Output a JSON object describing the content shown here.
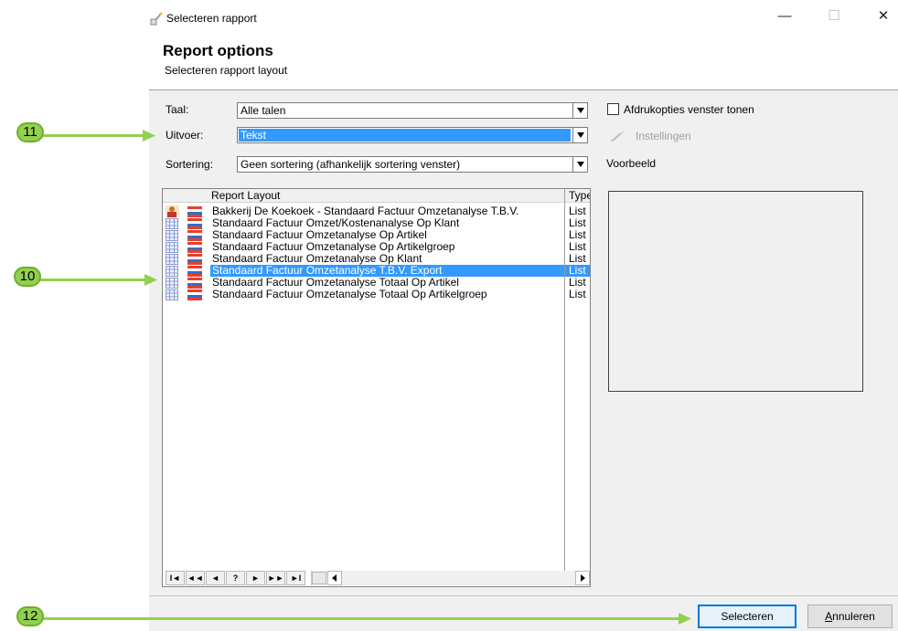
{
  "window": {
    "title": "Selecteren rapport",
    "minimize_glyph": "—",
    "maximize_glyph": "☐",
    "close_glyph": "✕"
  },
  "header": {
    "title": "Report options",
    "subtitle": "Selecteren rapport layout"
  },
  "form": {
    "taal_label": "Taal:",
    "taal_value": "Alle talen",
    "uitvoer_label": "Uitvoer:",
    "uitvoer_value": "Tekst",
    "sortering_label": "Sortering:",
    "sortering_value": "Geen sortering (afhankelijk sortering venster)"
  },
  "options": {
    "print_options_label": "Afdrukopties venster tonen",
    "print_options_checked": false,
    "instellingen_label": "Instellingen",
    "voorbeeld_label": "Voorbeeld"
  },
  "list": {
    "columns": [
      "Report Layout",
      "Type"
    ],
    "rows": [
      {
        "name": "Bakkerij De Koekoek - Standaard Factuur Omzetanalyse T.B.V.",
        "type": "List",
        "kind": "user",
        "selected": false
      },
      {
        "name": "Standaard Factuur Omzet/Kostenanalyse Op Klant",
        "type": "List",
        "kind": "grid",
        "selected": false
      },
      {
        "name": "Standaard Factuur Omzetanalyse Op Artikel",
        "type": "List",
        "kind": "grid",
        "selected": false
      },
      {
        "name": "Standaard Factuur Omzetanalyse Op Artikelgroep",
        "type": "List",
        "kind": "grid",
        "selected": false
      },
      {
        "name": "Standaard Factuur Omzetanalyse Op Klant",
        "type": "List",
        "kind": "grid",
        "selected": false
      },
      {
        "name": "Standaard Factuur Omzetanalyse T.B.V. Export",
        "type": "List",
        "kind": "grid",
        "selected": true
      },
      {
        "name": "Standaard Factuur Omzetanalyse Totaal Op Artikel",
        "type": "List",
        "kind": "grid",
        "selected": false
      },
      {
        "name": "Standaard Factuur Omzetanalyse Totaal Op Artikelgroep",
        "type": "List",
        "kind": "grid",
        "selected": false
      }
    ],
    "nav_buttons": [
      "I◄",
      "◄◄",
      "◄",
      "?",
      "►",
      "►►",
      "►I"
    ]
  },
  "buttons": {
    "select": "Selecteren",
    "cancel_prefix": "A",
    "cancel_rest": "nnuleren"
  },
  "callouts": {
    "list": "10",
    "uitvoer": "11",
    "select": "12",
    "color": "#92d050"
  },
  "colors": {
    "selection": "#3399ff",
    "panel": "#f0f0f0",
    "accent_border": "#0078d7"
  }
}
